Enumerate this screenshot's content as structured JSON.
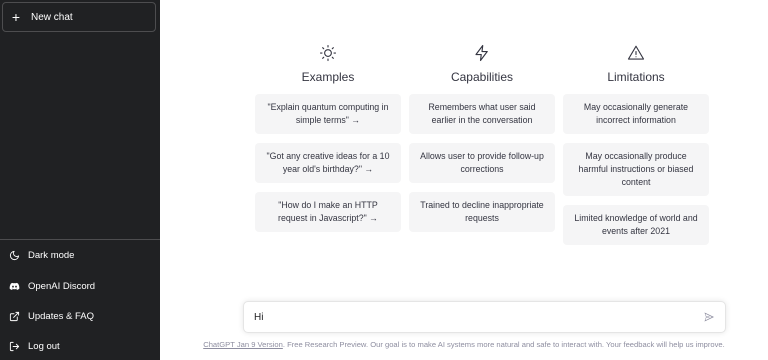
{
  "sidebar": {
    "new_chat": {
      "icon": "plus-icon",
      "label": "New chat"
    },
    "items": [
      {
        "icon": "moon-icon",
        "label": "Dark mode"
      },
      {
        "icon": "discord-icon",
        "label": "OpenAI Discord"
      },
      {
        "icon": "external-link-icon",
        "label": "Updates & FAQ"
      },
      {
        "icon": "logout-icon",
        "label": "Log out"
      }
    ]
  },
  "main": {
    "columns": [
      {
        "icon": "sun-icon",
        "title": "Examples",
        "cards": [
          "\"Explain quantum computing in simple terms\" →",
          "\"Got any creative ideas for a 10 year old's birthday?\" →",
          "\"How do I make an HTTP request in Javascript?\" →"
        ]
      },
      {
        "icon": "lightning-icon",
        "title": "Capabilities",
        "cards": [
          "Remembers what user said earlier in the conversation",
          "Allows user to provide follow-up corrections",
          "Trained to decline inappropriate requests"
        ]
      },
      {
        "icon": "warning-icon",
        "title": "Limitations",
        "cards": [
          "May occasionally generate incorrect information",
          "May occasionally produce harmful instructions or biased content",
          "Limited knowledge of world and events after 2021"
        ]
      }
    ]
  },
  "input": {
    "value": "Hi",
    "send_icon": "send-icon"
  },
  "footer": {
    "link": "ChatGPT Jan 9 Version",
    "text": ". Free Research Preview. Our goal is to make AI systems more natural and safe to interact with. Your feedback will help us improve."
  },
  "colors": {
    "sidebar_bg": "#202123",
    "card_bg": "#f5f5f6",
    "text": "#343541"
  }
}
